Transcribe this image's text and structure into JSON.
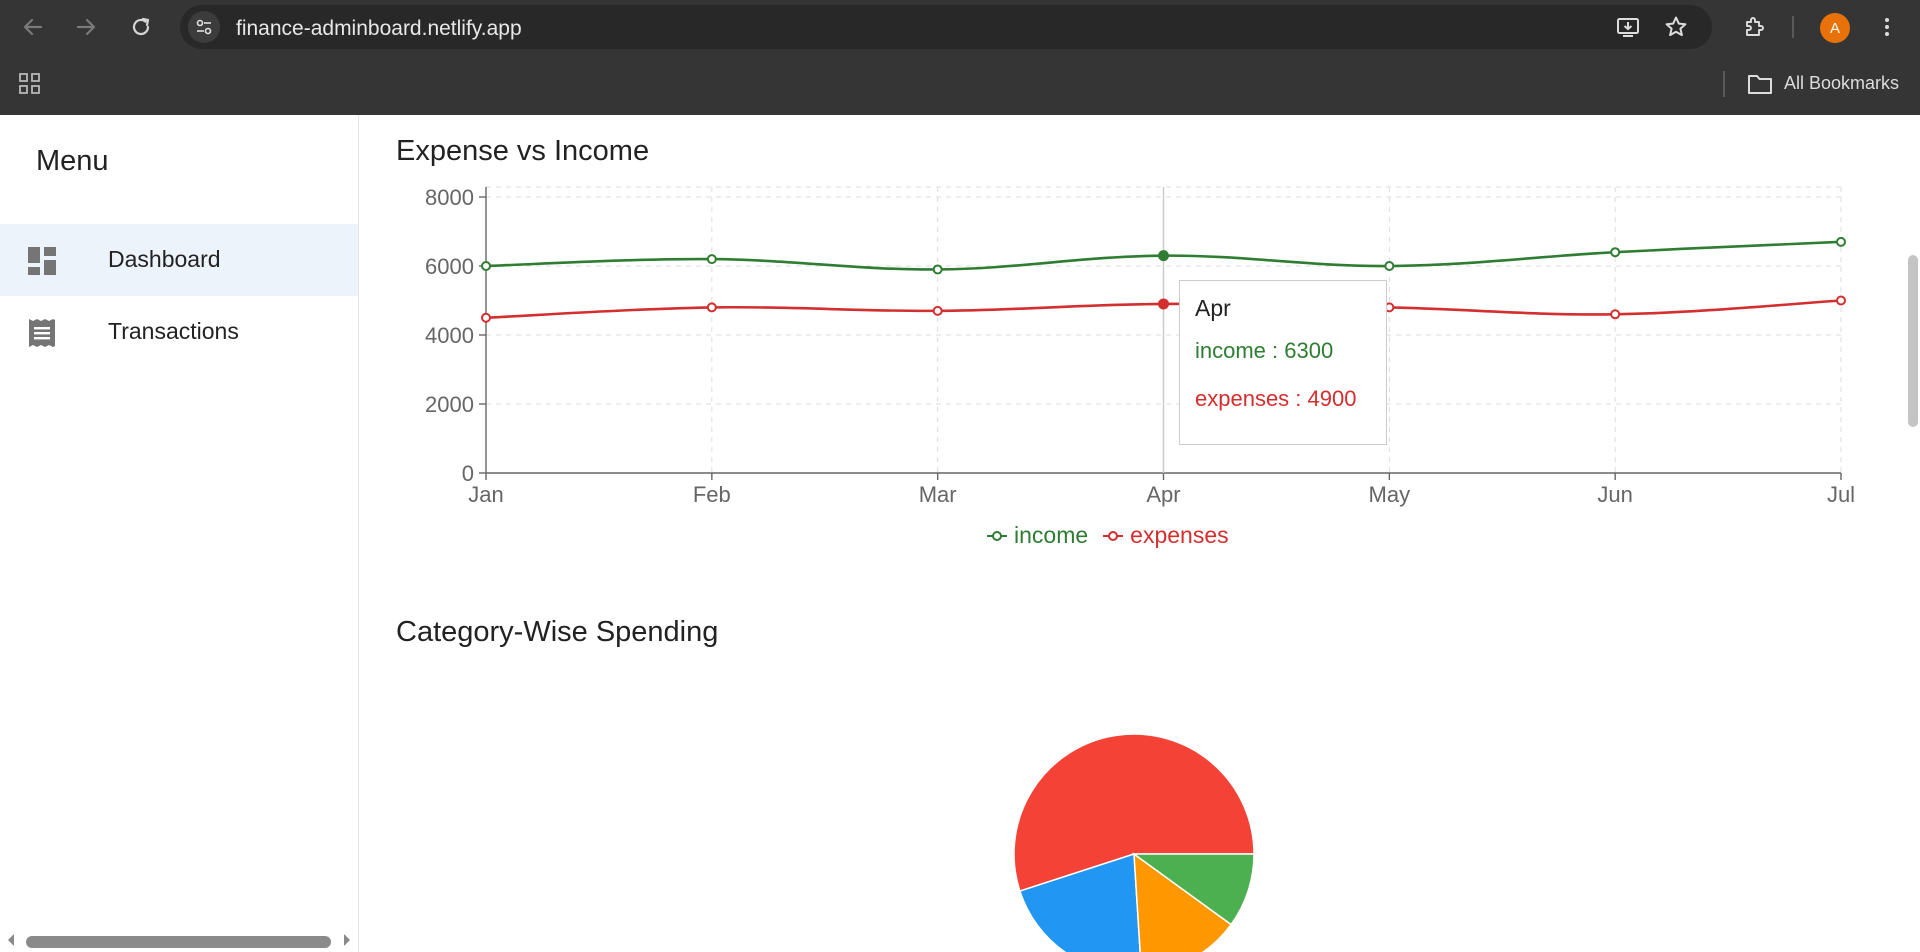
{
  "browser": {
    "url": "finance-adminboard.netlify.app",
    "bookmarks_label": "All Bookmarks",
    "profile_initial": "A"
  },
  "sidebar": {
    "title": "Menu",
    "items": [
      {
        "label": "Dashboard",
        "icon": "dashboard-icon",
        "active": true
      },
      {
        "label": "Transactions",
        "icon": "receipt-icon",
        "active": false
      }
    ]
  },
  "main": {
    "line_chart_title": "Expense vs Income",
    "pie_chart_title": "Category-Wise Spending"
  },
  "tooltip": {
    "label": "Apr",
    "income_text": "income : 6300",
    "expenses_text": "expenses : 4900"
  },
  "legend": {
    "income": "income",
    "expenses": "expenses"
  },
  "colors": {
    "income": "#2e7d32",
    "expenses": "#d32f2f",
    "active_nav_bg": "#edf3fb"
  },
  "chart_data": [
    {
      "type": "line",
      "title": "Expense vs Income",
      "categories": [
        "Jan",
        "Feb",
        "Mar",
        "Apr",
        "May",
        "Jun",
        "Jul"
      ],
      "series": [
        {
          "name": "income",
          "color": "#2e7d32",
          "values": [
            6000,
            6200,
            5900,
            6300,
            6000,
            6400,
            6700
          ]
        },
        {
          "name": "expenses",
          "color": "#d32f2f",
          "values": [
            4500,
            4800,
            4700,
            4900,
            4800,
            4600,
            5000
          ]
        }
      ],
      "yticks": [
        0,
        2000,
        4000,
        6000,
        8000
      ],
      "ylim": [
        0,
        8000
      ],
      "grid": true,
      "legend": "bottom"
    },
    {
      "type": "pie",
      "title": "Category-Wise Spending",
      "slices": [
        {
          "color": "#f44336",
          "value": 55
        },
        {
          "color": "#4caf50",
          "value": 10
        },
        {
          "color": "#ff9800",
          "value": 14
        },
        {
          "color": "#2196f3",
          "value": 21
        }
      ]
    }
  ]
}
